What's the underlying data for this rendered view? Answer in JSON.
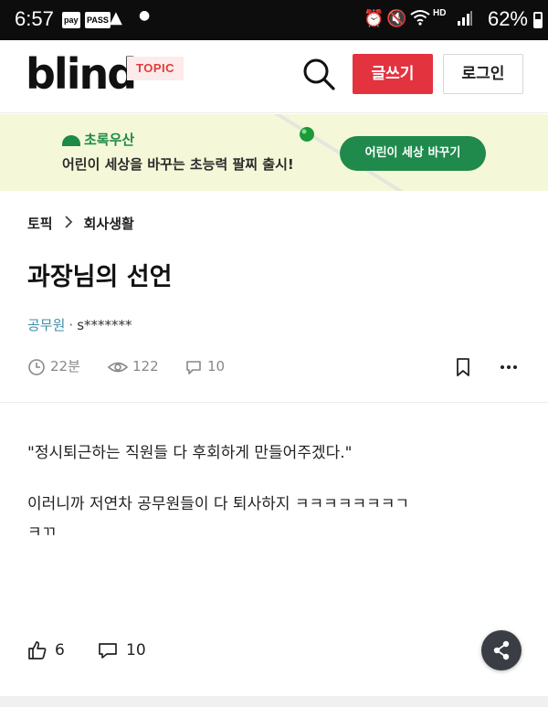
{
  "status_bar": {
    "time": "6:57",
    "badge_pay": "pay",
    "badge_pass": "PASS",
    "battery": "62%",
    "network_label": "HD"
  },
  "header": {
    "logo": "blind",
    "topic_badge": "TOPIC",
    "write_label": "글쓰기",
    "login_label": "로그인"
  },
  "banner": {
    "brand": "초록우산",
    "text": "어린이 세상을 바꾸는 초능력 팔찌 출시!",
    "button": "어린이 세상 바꾸기"
  },
  "article": {
    "breadcrumb": [
      "토픽",
      "회사생활"
    ],
    "title": "과장님의 선언",
    "author_org": "공무원",
    "author_sep": "·",
    "author_nick": "s*******",
    "time_ago": "22분",
    "views": "122",
    "comments": "10",
    "body": [
      "\"정시퇴근하는 직원들 다 후회하게 만들어주겠다.\"",
      "이러니까 저연차 공무원들이 다 퇴사하지 ㅋㅋㅋㅋㅋㅋㅋㄱ",
      "ㅋㄲ"
    ]
  },
  "actions": {
    "likes": "6",
    "comments": "10"
  },
  "colors": {
    "brand_red": "#e3333f",
    "banner_green": "#1f8a4c",
    "org_blue": "#3c8ea8"
  }
}
